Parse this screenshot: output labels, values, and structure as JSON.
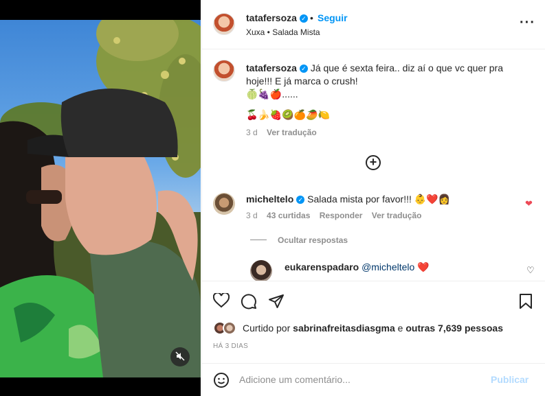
{
  "post": {
    "username": "tatafersoza",
    "follow_label": "Seguir",
    "location": "Xuxa • Salada Mista",
    "more_icon": "more-options-icon"
  },
  "caption": {
    "username": "tatafersoza",
    "text": "Já que é sexta feira.. diz aí o que vc quer pra hoje!!! E já marca o crush!",
    "emoji_line1": "🍈🍇🍎......",
    "emoji_line2": "🍒🍌🍓🥝🍊🥭🍋",
    "age": "3 d",
    "translate": "Ver tradução"
  },
  "comments": [
    {
      "username": "micheltelo",
      "text": "Salada mista por favor!!! 👶❤️👩",
      "age": "3 d",
      "likes": "43 curtidas",
      "reply": "Responder",
      "translate": "Ver tradução"
    }
  ],
  "hide_replies": "Ocultar respostas",
  "reply": {
    "username": "eukarenspadaro",
    "mention": "@micheltelo",
    "text": "❤️"
  },
  "likes": {
    "prefix": "Curtido por",
    "user": "sabrinafreitasdiasgma",
    "conj": "e",
    "others": "outras 7,639 pessoas"
  },
  "date": "HÁ 3 DIAS",
  "composer": {
    "placeholder": "Adicione um comentário...",
    "publish": "Publicar"
  },
  "colors": {
    "accent": "#0095f6",
    "like_red": "#ed4956",
    "publish_disabled": "#b3dbff"
  }
}
